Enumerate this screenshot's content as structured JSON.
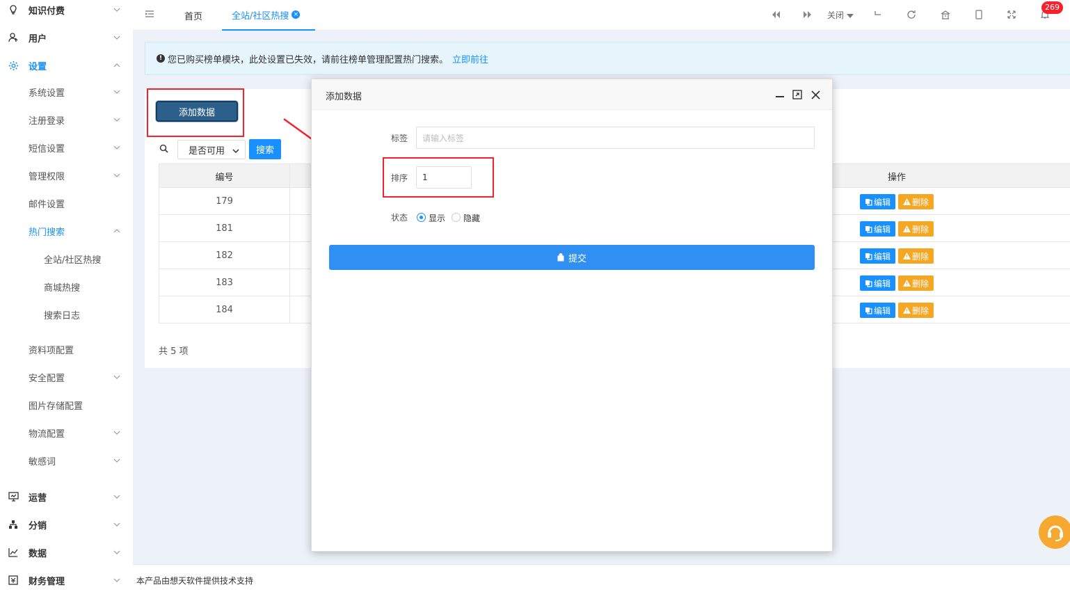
{
  "sidebar": {
    "items": [
      {
        "label": "知识付费",
        "level": "top",
        "icon": "lightbulb-icon",
        "arrow": "down"
      },
      {
        "label": "用户",
        "level": "top",
        "icon": "user-icon",
        "arrow": "down"
      },
      {
        "label": "设置",
        "level": "top",
        "icon": "gear-icon",
        "arrow": "up",
        "active": true
      },
      {
        "label": "系统设置",
        "level": "sub",
        "arrow": "down"
      },
      {
        "label": "注册登录",
        "level": "sub",
        "arrow": "down"
      },
      {
        "label": "短信设置",
        "level": "sub",
        "arrow": "down"
      },
      {
        "label": "管理权限",
        "level": "sub",
        "arrow": "down"
      },
      {
        "label": "邮件设置",
        "level": "sub",
        "arrow": ""
      },
      {
        "label": "热门搜索",
        "level": "sub",
        "arrow": "up",
        "active": true
      },
      {
        "label": "全站/社区热搜",
        "level": "subsub",
        "arrow": ""
      },
      {
        "label": "商城热搜",
        "level": "subsub",
        "arrow": ""
      },
      {
        "label": "搜索日志",
        "level": "subsub",
        "arrow": ""
      },
      {
        "label": "资料项配置",
        "level": "sub",
        "arrow": ""
      },
      {
        "label": "安全配置",
        "level": "sub",
        "arrow": "down"
      },
      {
        "label": "图片存储配置",
        "level": "sub",
        "arrow": ""
      },
      {
        "label": "物流配置",
        "level": "sub",
        "arrow": "down"
      },
      {
        "label": "敏感词",
        "level": "sub",
        "arrow": "down"
      },
      {
        "label": "运营",
        "level": "top",
        "icon": "monitor-icon",
        "arrow": "down"
      },
      {
        "label": "分销",
        "level": "top",
        "icon": "org-chart-icon",
        "arrow": "down"
      },
      {
        "label": "数据",
        "level": "top",
        "icon": "line-chart-icon",
        "arrow": "down"
      },
      {
        "label": "财务管理",
        "level": "top",
        "icon": "finance-icon",
        "arrow": "down"
      }
    ]
  },
  "topbar": {
    "tabs": [
      {
        "label": "首页"
      },
      {
        "label": "全站/社区热搜",
        "active": true
      }
    ],
    "close_label": "关闭",
    "notification_count": "269"
  },
  "notice": {
    "text": "您已购买榜单模块，此处设置已失效，请前往榜单管理配置热门搜索。",
    "link": "立即前往"
  },
  "toolbar": {
    "add_label": "添加数据",
    "select_value": "是否可用",
    "search_label": "搜索"
  },
  "table": {
    "headers": {
      "id": "编号",
      "actions": "操作"
    },
    "rows": [
      {
        "id": "179"
      },
      {
        "id": "181"
      },
      {
        "id": "182"
      },
      {
        "id": "183"
      },
      {
        "id": "184"
      }
    ],
    "edit_label": "编辑",
    "delete_label": "删除",
    "total": "共 5 项"
  },
  "modal": {
    "title": "添加数据",
    "tag_label": "标签",
    "tag_placeholder": "请输入标签",
    "sort_label": "排序",
    "sort_value": "1",
    "status_label": "状态",
    "status_show": "显示",
    "status_hide": "隐藏",
    "submit_label": "提交"
  },
  "footer": {
    "text": "本产品由想天软件提供技术支持"
  },
  "colors": {
    "primary": "#1890ff",
    "warning": "#f5a623",
    "highlight_box": "#f5222d"
  }
}
